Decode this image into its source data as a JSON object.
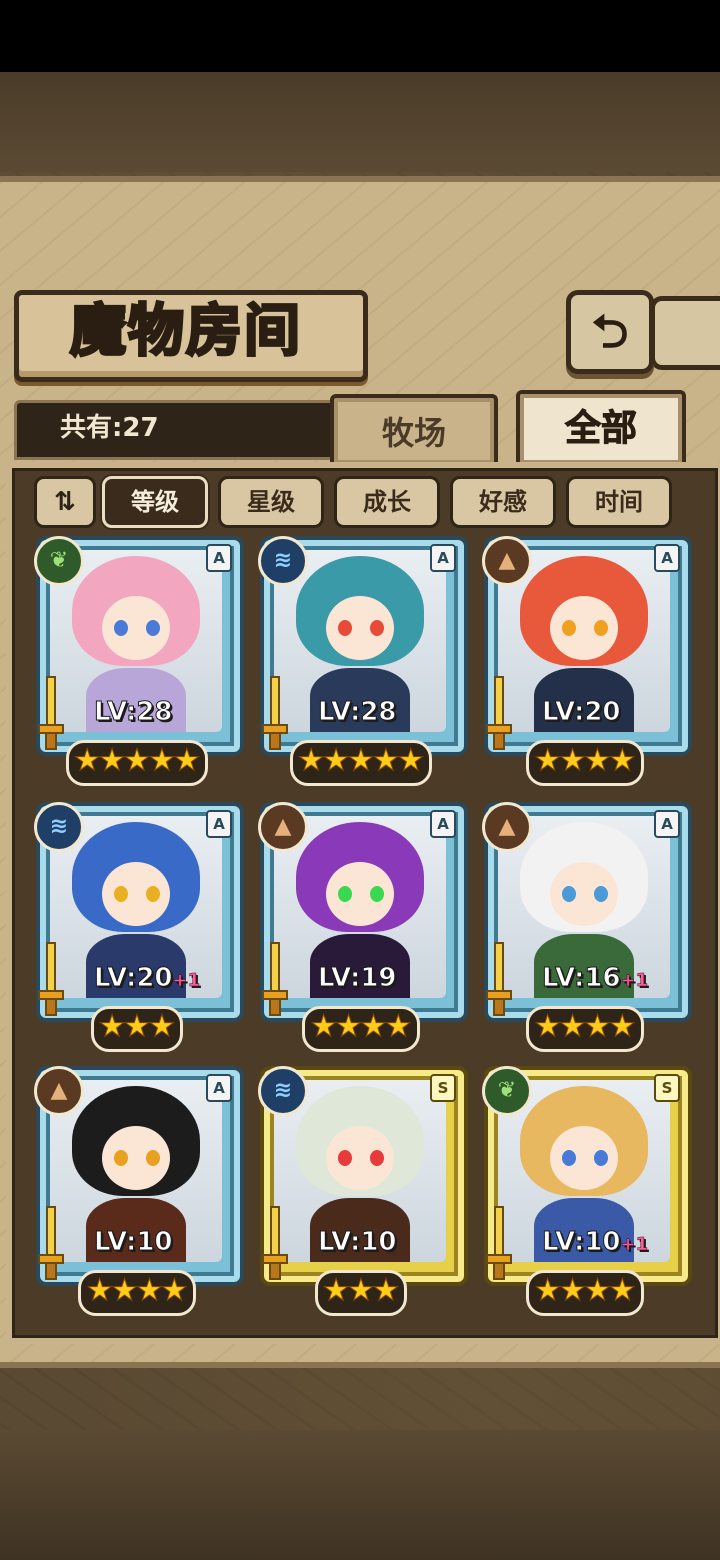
{
  "header": {
    "title": "魔物房间",
    "back_icon": "return-arrow-icon"
  },
  "count_label": "共有:27",
  "tabs": [
    {
      "label": "牧场",
      "active": false
    },
    {
      "label": "全部",
      "active": true
    }
  ],
  "sort": {
    "toggle_icon": "sort-order-icon",
    "toggle_glyph": "⇅",
    "options": [
      {
        "label": "等级",
        "active": true
      },
      {
        "label": "星级",
        "active": false
      },
      {
        "label": "成长",
        "active": false
      },
      {
        "label": "好感",
        "active": false
      },
      {
        "label": "时间",
        "active": false
      }
    ]
  },
  "monsters": [
    {
      "element": "nature",
      "rank": "A",
      "level": "LV:28",
      "plus": "",
      "stars": 5,
      "frame": "blue",
      "hair": "#f2a6c0",
      "outfit": "#b8a6d8",
      "eye": "#4a7ad8"
    },
    {
      "element": "water",
      "rank": "A",
      "level": "LV:28",
      "plus": "",
      "stars": 5,
      "frame": "blue",
      "hair": "#3a9aa8",
      "outfit": "#2a3a5a",
      "eye": "#e84a3a"
    },
    {
      "element": "earth",
      "rank": "A",
      "level": "LV:20",
      "plus": "",
      "stars": 4,
      "frame": "blue",
      "hair": "#e8583a",
      "outfit": "#24304a",
      "eye": "#f0a020"
    },
    {
      "element": "water",
      "rank": "A",
      "level": "LV:20",
      "plus": "+1",
      "stars": 3,
      "frame": "blue",
      "hair": "#3a6ac8",
      "outfit": "#2a3a6a",
      "eye": "#e8b020"
    },
    {
      "element": "earth",
      "rank": "A",
      "level": "LV:19",
      "plus": "",
      "stars": 4,
      "frame": "blue",
      "hair": "#8a3ab8",
      "outfit": "#2a1a3a",
      "eye": "#3ad850"
    },
    {
      "element": "earth",
      "rank": "A",
      "level": "LV:16",
      "plus": "+1",
      "stars": 4,
      "frame": "blue",
      "hair": "#f2f2f2",
      "outfit": "#3a6a3a",
      "eye": "#4a9ad8"
    },
    {
      "element": "earth",
      "rank": "A",
      "level": "LV:10",
      "plus": "",
      "stars": 4,
      "frame": "blue",
      "hair": "#1c1c1c",
      "outfit": "#5a2a1a",
      "eye": "#e8a020"
    },
    {
      "element": "water",
      "rank": "S",
      "level": "LV:10",
      "plus": "",
      "stars": 3,
      "frame": "gold",
      "hair": "#dfe8d8",
      "outfit": "#4a2a1a",
      "eye": "#e83a3a"
    },
    {
      "element": "nature",
      "rank": "S",
      "level": "LV:10",
      "plus": "+1",
      "stars": 4,
      "frame": "gold",
      "hair": "#e8b860",
      "outfit": "#3a5aa8",
      "eye": "#4a7ad8"
    }
  ]
}
